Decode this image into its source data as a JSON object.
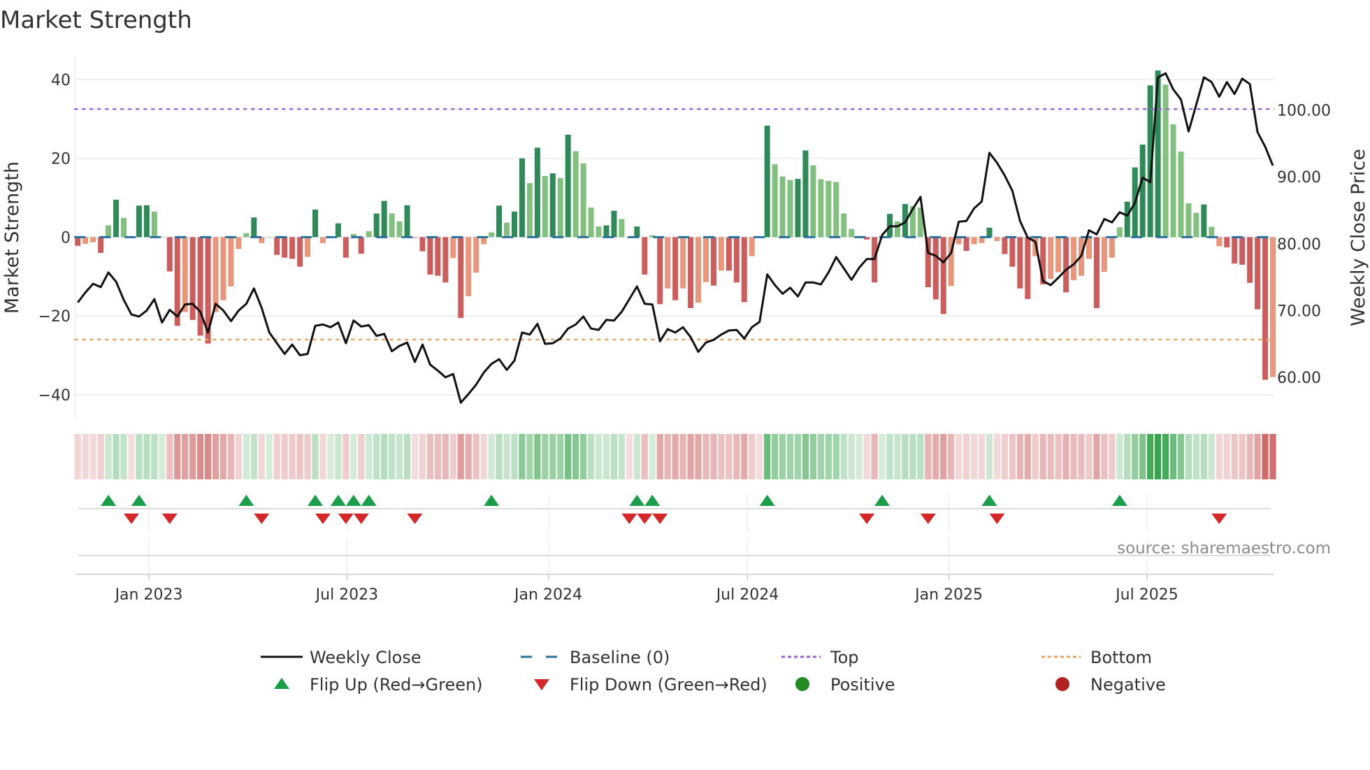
{
  "chart_data": {
    "type": "bar",
    "title": "Market Strength",
    "ylabel": "Market Strength",
    "y2label": "Weekly Close Price",
    "source": "source: sharemaestro.com",
    "frequency": "weekly",
    "start_date": "2022-10-28",
    "ylim": [
      -45,
      46
    ],
    "y2lim": [
      55.5,
      108
    ],
    "yticks": [
      {
        "v": 40,
        "label": "40"
      },
      {
        "v": 20,
        "label": "20"
      },
      {
        "v": 0,
        "label": "0"
      },
      {
        "v": -20,
        "label": "−20"
      },
      {
        "v": -40,
        "label": "−40"
      }
    ],
    "y2ticks": [
      {
        "v": 100,
        "label": "100.00"
      },
      {
        "v": 90,
        "label": "90.00"
      },
      {
        "v": 80,
        "label": "80.00"
      },
      {
        "v": 70,
        "label": "70.00"
      },
      {
        "v": 60,
        "label": "60.00"
      }
    ],
    "xticks": [
      {
        "date": "2023-01-01",
        "label": "Jan 2023"
      },
      {
        "date": "2023-07-01",
        "label": "Jul 2023"
      },
      {
        "date": "2024-01-01",
        "label": "Jan 2024"
      },
      {
        "date": "2024-07-01",
        "label": "Jul 2024"
      },
      {
        "date": "2025-01-01",
        "label": "Jan 2025"
      },
      {
        "date": "2025-07-01",
        "label": "Jul 2025"
      }
    ],
    "top_level": 32.5,
    "bottom_level": -26,
    "grid": true,
    "legend_placement": "bottom-center",
    "colors": {
      "positive_strong": "#2e8b57",
      "positive_weak": "#82c080",
      "negative_strong": "#cd5c5c",
      "negative_weak": "#e9967a",
      "baseline": "#2b6f9e",
      "top": "#9b5fe0",
      "bottom": "#f0a35e",
      "close": "#111111",
      "flip_up": "#1a9e4a",
      "flip_down": "#d62728",
      "positive_dot": "#228b22",
      "negative_dot": "#b22222"
    },
    "strength": [
      -2.2,
      -1.7,
      -1.3,
      -4,
      3,
      9.5,
      4.9,
      -0.2,
      8,
      8.1,
      6.5,
      0,
      -8.7,
      -22.5,
      -19,
      -21,
      -25,
      -27,
      -19,
      -16,
      -12.5,
      -3,
      1,
      5,
      -1.5,
      0,
      -4.5,
      -5.2,
      -5.5,
      -7.5,
      -5,
      7,
      -1.5,
      0,
      3.5,
      -5.2,
      0.8,
      -4.2,
      1.5,
      6,
      9.2,
      6,
      4,
      8.1,
      -0.2,
      -3.6,
      -9.5,
      -9.8,
      -11.5,
      -5.3,
      -20.5,
      -15,
      -9,
      -1.8,
      1.2,
      8,
      3.7,
      6.5,
      20,
      13.7,
      22.7,
      15.5,
      16.2,
      15,
      26,
      21.8,
      18.7,
      7.5,
      2.7,
      3,
      6.7,
      4.6,
      -0.2,
      2.7,
      -9.5,
      0.5,
      -17,
      -13,
      -16,
      -13,
      -18,
      -16.6,
      -11.4,
      -12.3,
      -8.5,
      -8.5,
      -11.5,
      -16.5,
      -4.8,
      -0.2,
      28.3,
      18.5,
      15.4,
      14.5,
      14.8,
      22,
      18.2,
      14.7,
      14.3,
      14,
      6,
      2.1,
      0.3,
      -0.6,
      -11.5,
      0.2,
      5.9,
      4,
      8.4,
      7.9,
      7.5,
      -12.7,
      -15.8,
      -19.5,
      -12.4,
      -1.8,
      -3.5,
      -1.8,
      -1.5,
      2.4,
      -1,
      -4.3,
      -7.5,
      -13,
      -15.7,
      -4.8,
      -12,
      -10.6,
      -8.9,
      -14,
      -10.9,
      -9.8,
      -5.5,
      -18,
      -8.8,
      -5.2,
      2.5,
      9,
      17.7,
      23.5,
      38.5,
      42.3,
      38.7,
      28.6,
      21.7,
      8.6,
      6.2,
      8.3,
      2.6,
      -2.3,
      -2.6,
      -6.7,
      -7,
      -11.6,
      -18.3,
      -36.2,
      -35.5
    ],
    "weekly_close": [
      71.2,
      72.7,
      74.0,
      73.5,
      75.7,
      74.3,
      71.6,
      69.4,
      69.1,
      70.0,
      71.7,
      68.2,
      70.1,
      69.1,
      70.9,
      71.0,
      69.8,
      66.7,
      71.0,
      70.0,
      68.4,
      70.0,
      71.0,
      73.3,
      70.4,
      66.7,
      65.1,
      63.5,
      64.9,
      63.3,
      63.5,
      67.7,
      67.9,
      67.5,
      68.2,
      65.1,
      68.5,
      67.6,
      67.8,
      66.2,
      66.5,
      63.9,
      64.7,
      65.2,
      62.3,
      64.9,
      61.9,
      61.0,
      60.0,
      60.5,
      56.2,
      57.5,
      58.9,
      60.7,
      62.0,
      62.7,
      61.1,
      62.5,
      66.7,
      66.4,
      68.0,
      65.0,
      65.1,
      65.8,
      67.3,
      67.9,
      69.1,
      67.3,
      67.1,
      68.6,
      68.5,
      69.8,
      71.7,
      73.6,
      71.0,
      70.9,
      65.4,
      67.2,
      66.7,
      67.5,
      66.0,
      63.8,
      65.2,
      65.6,
      66.4,
      67.0,
      67.1,
      65.8,
      67.5,
      68.3,
      75.4,
      73.8,
      72.5,
      73.4,
      72.1,
      74.2,
      74.2,
      73.9,
      75.7,
      78.0,
      76.3,
      74.6,
      76.4,
      77.7,
      77.7,
      81.3,
      82.6,
      82.6,
      83.2,
      85.2,
      87.0,
      78.6,
      78.2,
      77.2,
      78.6,
      83.3,
      83.4,
      85.3,
      86.3,
      93.6,
      92.1,
      90.2,
      87.9,
      83.4,
      80.9,
      80.3,
      74.4,
      73.8,
      74.9,
      76.1,
      76.9,
      78.2,
      82.0,
      81.4,
      83.7,
      83.2,
      84.7,
      84.2,
      86.1,
      89.9,
      89.2,
      104.9,
      105.5,
      103.1,
      101.6,
      96.8,
      100.8,
      104.9,
      104.2,
      102.0,
      104.2,
      102.4,
      104.7,
      103.9,
      96.7,
      94.5,
      91.7
    ],
    "flip_up_weeks": [
      4,
      8,
      22,
      31,
      34,
      36,
      38,
      54,
      73,
      75,
      90,
      105,
      119,
      136
    ],
    "flip_down_weeks": [
      7,
      12,
      24,
      32,
      35,
      37,
      44,
      72,
      74,
      76,
      103,
      111,
      120,
      149
    ],
    "legend": [
      {
        "key": "close",
        "label": "Weekly Close"
      },
      {
        "key": "baseline",
        "label": "Baseline (0)"
      },
      {
        "key": "top",
        "label": "Top"
      },
      {
        "key": "bottom",
        "label": "Bottom"
      },
      {
        "key": "flip_up",
        "label": "Flip Up (Red→Green)"
      },
      {
        "key": "flip_down",
        "label": "Flip Down (Green→Red)"
      },
      {
        "key": "positive",
        "label": "Positive"
      },
      {
        "key": "negative",
        "label": "Negative"
      }
    ]
  }
}
